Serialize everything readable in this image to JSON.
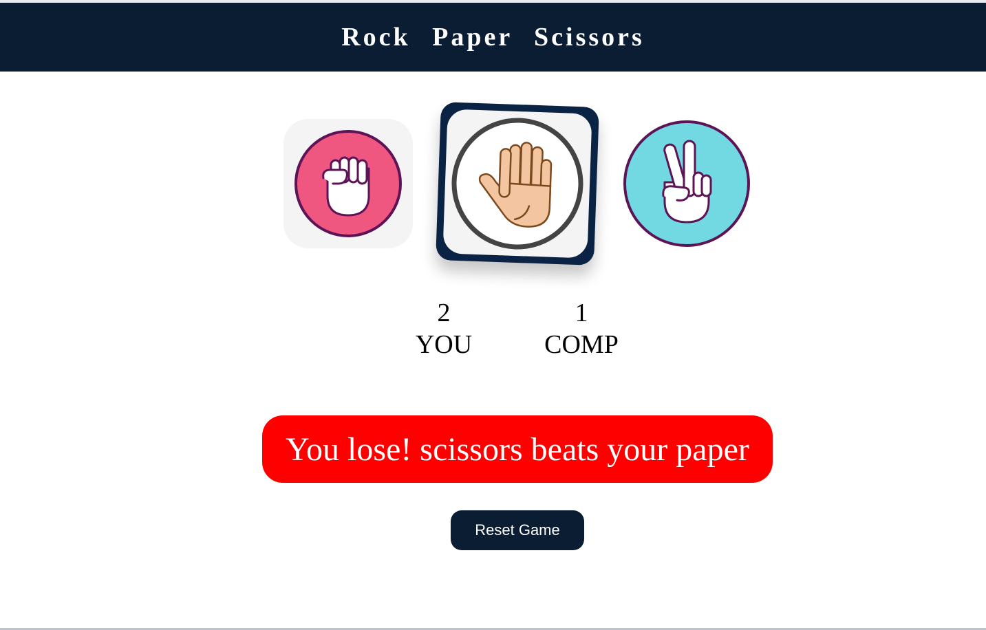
{
  "header": {
    "title": "Rock Paper Scissors"
  },
  "choices": [
    {
      "id": "rock",
      "icon": "fist-icon",
      "color": "#ef5680"
    },
    {
      "id": "paper",
      "icon": "open-hand-icon",
      "color": "#ffffff",
      "selected": true
    },
    {
      "id": "scissors",
      "icon": "peace-hand-icon",
      "color": "#72d9e2"
    }
  ],
  "score": {
    "user": {
      "value": "2",
      "label": "YOU"
    },
    "comp": {
      "value": "1",
      "label": "COMP"
    }
  },
  "message": {
    "text": "You lose! scissors beats your paper",
    "color": "#ff0000"
  },
  "reset": {
    "label": "Reset Game"
  },
  "colors": {
    "navy": "#0a1d33",
    "accent_outline": "#5d1456"
  }
}
